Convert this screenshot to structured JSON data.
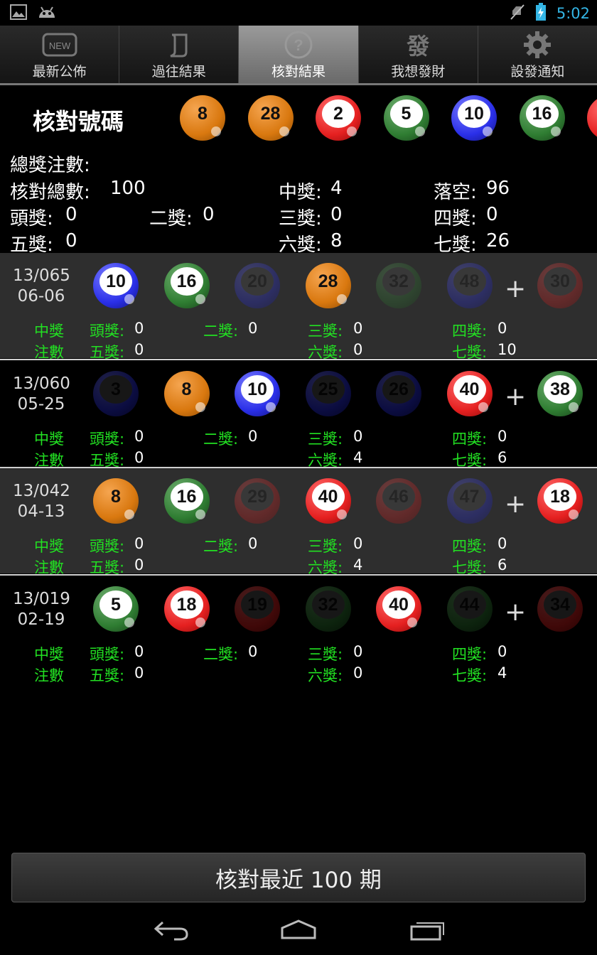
{
  "status": {
    "time": "5:02"
  },
  "tabs": [
    {
      "label": "最新公佈",
      "icon": "new-icon",
      "icon_text": "NEW"
    },
    {
      "label": "過往結果",
      "icon": "scroll-icon"
    },
    {
      "label": "核對結果",
      "icon": "question-icon",
      "active": true
    },
    {
      "label": "我想發財",
      "icon": "fa-tile-icon",
      "icon_text": "發"
    },
    {
      "label": "設發通知",
      "icon": "gear-icon"
    }
  ],
  "check": {
    "title": "核對號碼",
    "numbers": [
      {
        "n": "8",
        "color": "orange"
      },
      {
        "n": "28",
        "color": "orange"
      },
      {
        "n": "2",
        "color": "red"
      },
      {
        "n": "5",
        "color": "green"
      },
      {
        "n": "10",
        "color": "blue"
      },
      {
        "n": "16",
        "color": "green"
      }
    ]
  },
  "summary": {
    "header": "總獎注數:",
    "total_label": "核對總數:",
    "total": "100",
    "win_label": "中獎:",
    "win": "4",
    "miss_label": "落空:",
    "miss": "96",
    "p1_label": "頭獎:",
    "p1": "0",
    "p2_label": "二獎:",
    "p2": "0",
    "p3_label": "三獎:",
    "p3": "0",
    "p4_label": "四獎:",
    "p4": "0",
    "p5_label": "五獎:",
    "p5": "0",
    "p6_label": "六獎:",
    "p6": "8",
    "p7_label": "七獎:",
    "p7": "26"
  },
  "labels": {
    "win_line1": "中獎",
    "win_line2": "注數",
    "p1": "頭獎:",
    "p2": "二獎:",
    "p3": "三獎:",
    "p4": "四獎:",
    "p5": "五獎:",
    "p6": "六獎:",
    "p7": "七獎:",
    "plus": "+"
  },
  "results": [
    {
      "draw": "13/065",
      "date": "06-06",
      "balls": [
        {
          "n": "10",
          "color": "blue",
          "hit": true
        },
        {
          "n": "16",
          "color": "green",
          "hit": true
        },
        {
          "n": "20",
          "color": "blue",
          "hit": false
        },
        {
          "n": "28",
          "color": "orange",
          "hit": true
        },
        {
          "n": "32",
          "color": "green",
          "hit": false
        },
        {
          "n": "48",
          "color": "blue",
          "hit": false
        }
      ],
      "special": {
        "n": "30",
        "color": "red",
        "hit": false
      },
      "p1": "0",
      "p2": "0",
      "p3": "0",
      "p4": "0",
      "p5": "0",
      "p6": "0",
      "p7": "10"
    },
    {
      "draw": "13/060",
      "date": "05-25",
      "balls": [
        {
          "n": "3",
          "color": "blue",
          "hit": false
        },
        {
          "n": "8",
          "color": "orange",
          "hit": true
        },
        {
          "n": "10",
          "color": "blue",
          "hit": true
        },
        {
          "n": "25",
          "color": "blue",
          "hit": false
        },
        {
          "n": "26",
          "color": "blue",
          "hit": false
        },
        {
          "n": "40",
          "color": "red",
          "hit": true
        }
      ],
      "special": {
        "n": "38",
        "color": "green",
        "hit": true
      },
      "p1": "0",
      "p2": "0",
      "p3": "0",
      "p4": "0",
      "p5": "0",
      "p6": "4",
      "p7": "6"
    },
    {
      "draw": "13/042",
      "date": "04-13",
      "balls": [
        {
          "n": "8",
          "color": "orange",
          "hit": true
        },
        {
          "n": "16",
          "color": "green",
          "hit": true
        },
        {
          "n": "29",
          "color": "red",
          "hit": false
        },
        {
          "n": "40",
          "color": "red",
          "hit": true
        },
        {
          "n": "46",
          "color": "red",
          "hit": false
        },
        {
          "n": "47",
          "color": "blue",
          "hit": false
        }
      ],
      "special": {
        "n": "18",
        "color": "red",
        "hit": true
      },
      "p1": "0",
      "p2": "0",
      "p3": "0",
      "p4": "0",
      "p5": "0",
      "p6": "4",
      "p7": "6"
    },
    {
      "draw": "13/019",
      "date": "02-19",
      "balls": [
        {
          "n": "5",
          "color": "green",
          "hit": true
        },
        {
          "n": "18",
          "color": "red",
          "hit": true
        },
        {
          "n": "19",
          "color": "red",
          "hit": false
        },
        {
          "n": "32",
          "color": "green",
          "hit": false
        },
        {
          "n": "40",
          "color": "red",
          "hit": true
        },
        {
          "n": "44",
          "color": "green",
          "hit": false
        }
      ],
      "special": {
        "n": "34",
        "color": "red",
        "hit": false
      },
      "p1": "0",
      "p2": "0",
      "p3": "0",
      "p4": "0",
      "p5": "0",
      "p6": "0",
      "p7": "4"
    }
  ],
  "bottom_button": "核對最近 100 期",
  "nav": {
    "back": "back-icon",
    "home": "home-icon",
    "recent": "recent-apps-icon"
  }
}
